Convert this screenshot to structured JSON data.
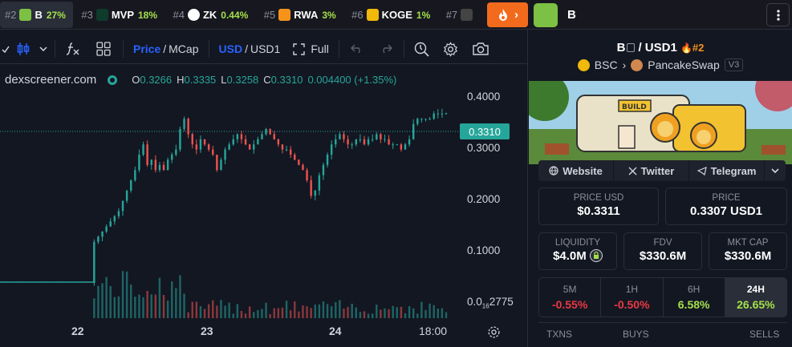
{
  "trending": [
    {
      "rank": "#2",
      "symbol": "B",
      "change": "27%",
      "icon_color": "#7cc144",
      "active": true
    },
    {
      "rank": "#3",
      "symbol": "MVP",
      "change": "18%",
      "icon_color": "#0e3b2c"
    },
    {
      "rank": "#4",
      "symbol": "ZK",
      "change": "0.44%",
      "icon_color": "#ffffff"
    },
    {
      "rank": "#5",
      "symbol": "RWA",
      "change": "3%",
      "icon_color": "#f7931a"
    },
    {
      "rank": "#6",
      "symbol": "KOGE",
      "change": "1%",
      "icon_color": "#f0b90b"
    },
    {
      "rank": "#7",
      "symbol": "",
      "change": "",
      "icon_color": "#444"
    }
  ],
  "header": {
    "pair_symbol": "B",
    "menu_icon": "kebab-icon",
    "fire_icon": "fire-icon",
    "fire_arrow": "›"
  },
  "toolbar": {
    "price_label": "Price",
    "mcap_label": "MCap",
    "usd_label": "USD",
    "usd1_label": "USD1",
    "full_label": "Full",
    "sep": "/"
  },
  "chart": {
    "site": "dexscreener.com",
    "o_label": "O",
    "o_value": "0.3266",
    "h_label": "H",
    "h_value": "0.3335",
    "l_label": "L",
    "l_value": "0.3258",
    "c_label": "C",
    "c_value": "0.3310",
    "change": "0.004400 (+1.35%)",
    "current_price": "0.3310",
    "y_label_04": "0.4000",
    "y_label_03": "0.3000",
    "y_label_02": "0.2000",
    "y_label_01": "0.1000",
    "y_label_low_a": "0.0",
    "y_label_low_sub": "16",
    "y_label_low_b": "2775",
    "x_label_22": "22",
    "x_label_23": "23",
    "x_label_24": "24",
    "x_label_1800": "18:00"
  },
  "chart_data": {
    "type": "candlestick",
    "x_ticks": [
      "22",
      "23",
      "24",
      "18:00"
    ],
    "y_ticks": [
      "0.4000",
      "0.3000",
      "0.2000",
      "0.1000"
    ],
    "close_series": [
      0.0,
      0.0,
      0.0,
      0.0,
      0.0,
      0.0,
      0.0,
      0.0,
      0.0,
      0.0,
      0.0,
      0.0,
      0.0,
      0.0,
      0.0,
      0.0,
      0.0,
      0.0,
      0.0,
      0.0,
      0.0,
      0.0,
      0.0,
      0.08,
      0.09,
      0.1,
      0.11,
      0.12,
      0.13,
      0.14,
      0.16,
      0.18,
      0.2,
      0.22,
      0.25,
      0.27,
      0.23,
      0.24,
      0.22,
      0.23,
      0.22,
      0.24,
      0.25,
      0.26,
      0.3,
      0.32,
      0.29,
      0.27,
      0.26,
      0.28,
      0.27,
      0.26,
      0.25,
      0.22,
      0.24,
      0.26,
      0.27,
      0.28,
      0.29,
      0.28,
      0.27,
      0.26,
      0.27,
      0.28,
      0.29,
      0.3,
      0.29,
      0.28,
      0.27,
      0.26,
      0.26,
      0.25,
      0.24,
      0.23,
      0.22,
      0.2,
      0.17,
      0.18,
      0.21,
      0.23,
      0.25,
      0.27,
      0.28,
      0.29,
      0.28,
      0.27,
      0.27,
      0.28,
      0.28,
      0.27,
      0.28,
      0.28,
      0.29,
      0.28,
      0.28,
      0.27,
      0.27,
      0.27,
      0.26,
      0.27,
      0.28,
      0.31,
      0.32,
      0.32,
      0.32,
      0.32,
      0.33,
      0.33,
      0.33,
      0.331
    ]
  },
  "panel": {
    "base": "B",
    "slash": "/",
    "quote": "USD1",
    "rank": "#2",
    "chain": "BSC",
    "dex": "PancakeSwap",
    "version": "V3",
    "banner_text": "BUILD",
    "website": "Website",
    "twitter": "Twitter",
    "telegram": "Telegram",
    "price_usd_label": "PRICE USD",
    "price_usd": "$0.3311",
    "price_label": "PRICE",
    "price": "0.3307 USD1",
    "liquidity_label": "LIQUIDITY",
    "liquidity": "$4.0M",
    "fdv_label": "FDV",
    "fdv": "$330.6M",
    "mktcap_label": "MKT CAP",
    "mktcap": "$330.6M",
    "tabs": [
      {
        "label": "5M",
        "value": "-0.55%",
        "dir": "neg"
      },
      {
        "label": "1H",
        "value": "-0.50%",
        "dir": "neg"
      },
      {
        "label": "6H",
        "value": "6.58%",
        "dir": "pos"
      },
      {
        "label": "24H",
        "value": "26.65%",
        "dir": "pos",
        "selected": true
      }
    ],
    "txns_label": "TXNS",
    "buys_label": "BUYS",
    "sells_label": "SELLS"
  }
}
